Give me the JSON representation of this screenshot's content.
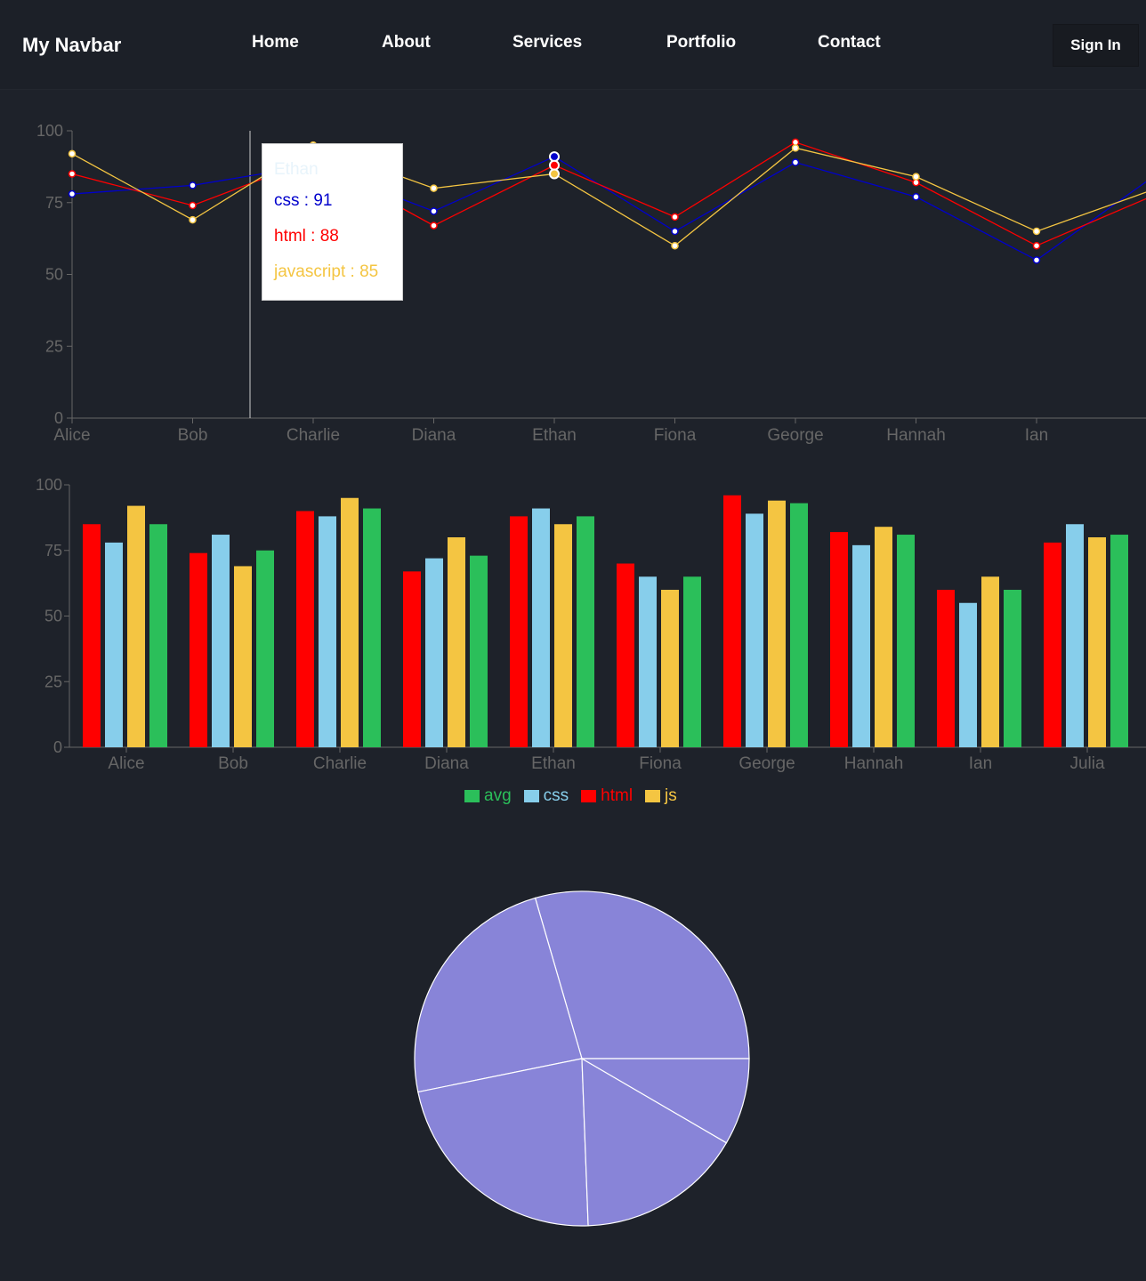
{
  "navbar": {
    "brand": "My Navbar",
    "links": [
      "Home",
      "About",
      "Services",
      "Portfolio",
      "Contact"
    ],
    "signin": "Sign In"
  },
  "colors": {
    "background": "#1e222a",
    "css": "#87ceeb",
    "css_line": "#0000cc",
    "html": "#ff0000",
    "js": "#f4c542",
    "avg": "#2bbf5a",
    "pie": "#8884d8"
  },
  "tooltip": {
    "title": "Ethan",
    "css_text": "css : 91",
    "html_text": "html : 88",
    "js_text": "javascript : 85"
  },
  "legend": {
    "items": [
      "avg",
      "css",
      "html",
      "js"
    ]
  },
  "chart_data": [
    {
      "type": "line",
      "x": [
        "Alice",
        "Bob",
        "Charlie",
        "Diana",
        "Ethan",
        "Fiona",
        "George",
        "Hannah",
        "Ian",
        "Julia"
      ],
      "x_visible": [
        "Alice",
        "Bob",
        "Charlie",
        "Diana",
        "Ethan",
        "Fiona",
        "George",
        "Hannah",
        "Ian",
        "Ju"
      ],
      "series": [
        {
          "name": "css",
          "values": [
            78,
            81,
            88,
            72,
            91,
            65,
            89,
            77,
            55,
            85
          ]
        },
        {
          "name": "html",
          "values": [
            85,
            74,
            90,
            67,
            88,
            70,
            96,
            82,
            60,
            78
          ]
        },
        {
          "name": "javascript",
          "values": [
            92,
            69,
            95,
            80,
            85,
            60,
            94,
            84,
            65,
            80
          ]
        }
      ],
      "yticks": [
        "0",
        "25",
        "50",
        "75",
        "100"
      ],
      "ylim": [
        0,
        100
      ],
      "active_point": "Ethan",
      "grid": false
    },
    {
      "type": "bar",
      "categories": [
        "Alice",
        "Bob",
        "Charlie",
        "Diana",
        "Ethan",
        "Fiona",
        "George",
        "Hannah",
        "Ian",
        "Julia"
      ],
      "series": [
        {
          "name": "html",
          "values": [
            85,
            74,
            90,
            67,
            88,
            70,
            96,
            82,
            60,
            78
          ]
        },
        {
          "name": "css",
          "values": [
            78,
            81,
            88,
            72,
            91,
            65,
            89,
            77,
            55,
            85
          ]
        },
        {
          "name": "js",
          "values": [
            92,
            69,
            95,
            80,
            85,
            60,
            94,
            84,
            65,
            80
          ]
        },
        {
          "name": "avg",
          "values": [
            85,
            75,
            91,
            73,
            88,
            65,
            93,
            81,
            60,
            81
          ]
        }
      ],
      "yticks": [
        "0",
        "25",
        "50",
        "75",
        "100"
      ],
      "ylim": [
        0,
        100
      ],
      "legend": "bottom-center",
      "grid": false
    },
    {
      "type": "pie",
      "slices": [
        {
          "value": 29.5
        },
        {
          "value": 23.7
        },
        {
          "value": 22.4
        },
        {
          "value": 16.0
        },
        {
          "value": 8.4
        }
      ]
    }
  ]
}
